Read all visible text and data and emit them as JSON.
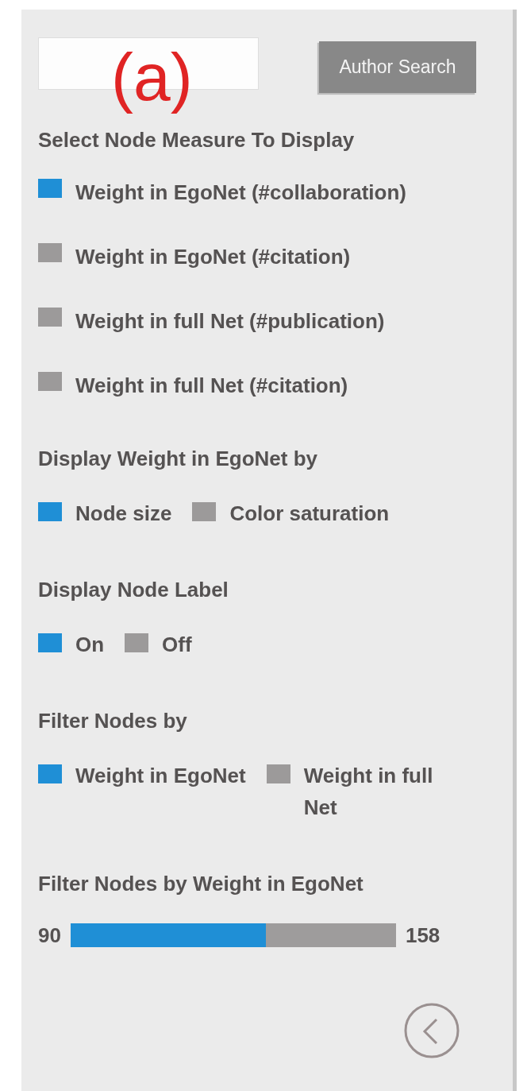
{
  "figure_label": "(a)",
  "search": {
    "button": "Author Search"
  },
  "sections": [
    {
      "kind": "stacked_options",
      "heading": "Select Node Measure To Display",
      "options": [
        {
          "label": "Weight in EgoNet (#collaboration)",
          "selected": true
        },
        {
          "label": "Weight in EgoNet (#citation)",
          "selected": false
        },
        {
          "label": "Weight in full Net (#publication)",
          "selected": false
        },
        {
          "label": "Weight in full Net (#citation)",
          "selected": false
        }
      ]
    },
    {
      "kind": "inline_options",
      "heading": "Display Weight in EgoNet by",
      "options": [
        {
          "label": "Node size",
          "selected": true
        },
        {
          "label": "Color saturation",
          "selected": false
        }
      ]
    },
    {
      "kind": "inline_options",
      "heading": "Display Node Label",
      "options": [
        {
          "label": "On",
          "selected": true
        },
        {
          "label": "Off",
          "selected": false
        }
      ]
    },
    {
      "kind": "inline_options",
      "heading": "Filter Nodes by",
      "options": [
        {
          "label": "Weight in EgoNet",
          "selected": true
        },
        {
          "label": "Weight in full Net",
          "selected": false
        }
      ]
    },
    {
      "kind": "slider",
      "heading": "Filter Nodes by Weight in EgoNet",
      "min": "90",
      "max": "158",
      "level": 0.6
    }
  ]
}
